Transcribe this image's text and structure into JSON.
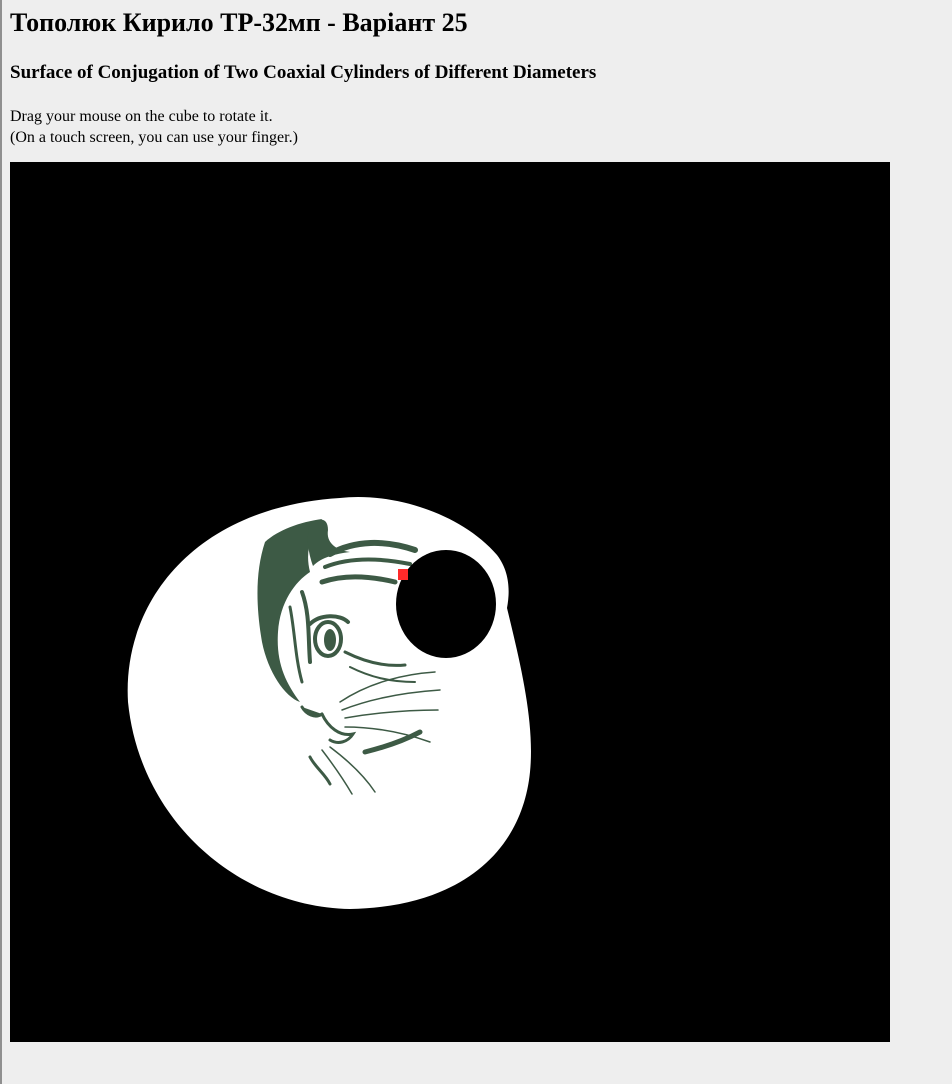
{
  "header": {
    "title": "Тополюк Кирило ТР-32мп - Варіант 25",
    "subtitle": "Surface of Conjugation of Two Coaxial Cylinders of Different Diameters"
  },
  "instructions": {
    "line1": "Drag your mouse on the cube to rotate it.",
    "line2": "(On a touch screen, you can use your finger.)"
  },
  "colors": {
    "page_background": "#eeeeee",
    "canvas_background": "#000000",
    "surface": "#ffffff",
    "texture_ink": "#3d5a45",
    "marker": "#ff2a2a"
  },
  "canvas": {
    "content": "textured-cat-surface",
    "marker_icon": "red-square-marker"
  }
}
